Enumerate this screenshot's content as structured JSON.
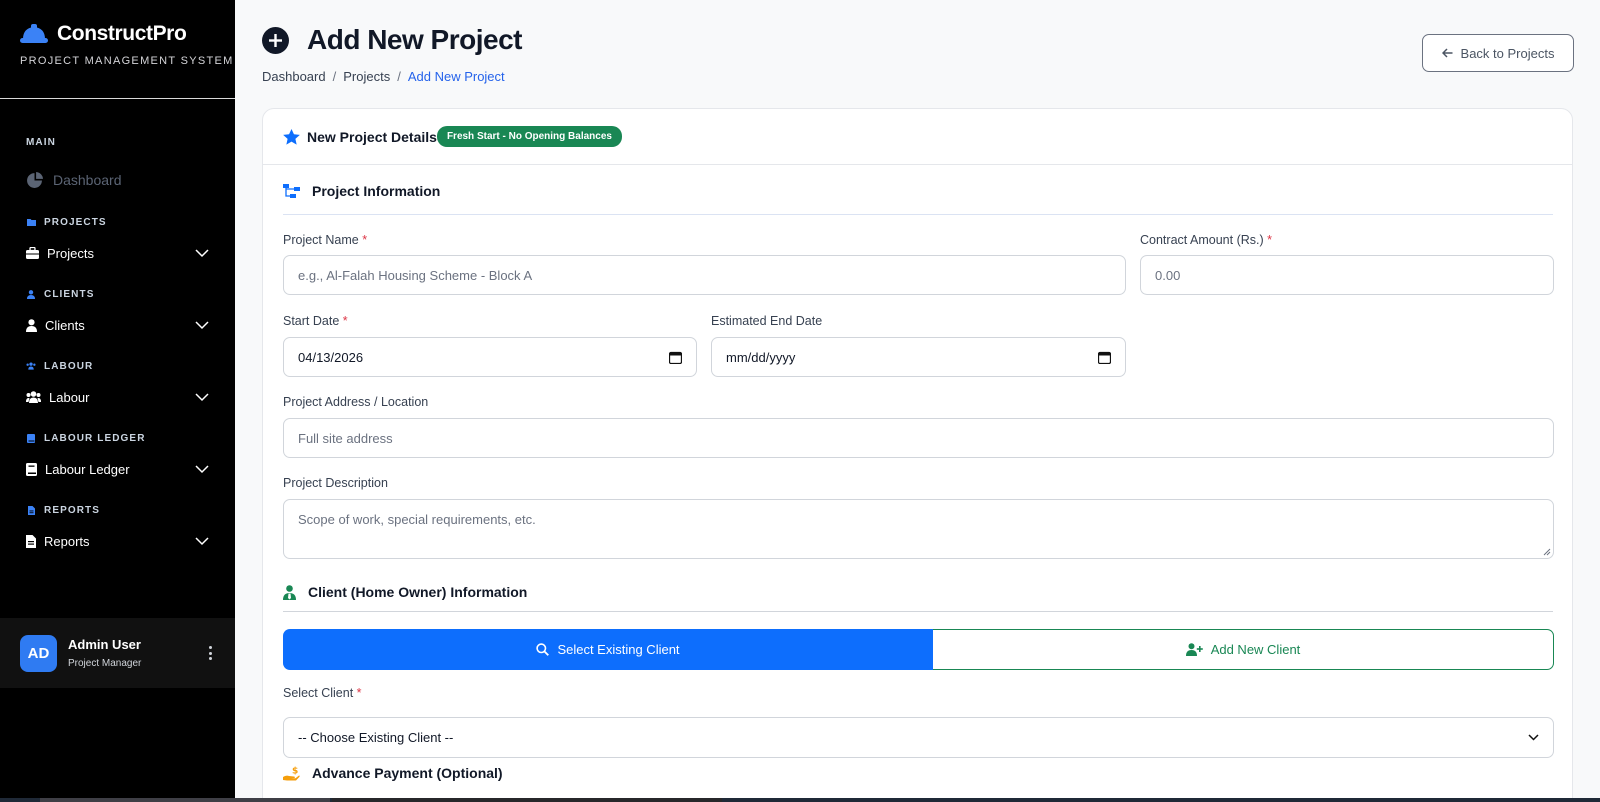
{
  "brand": {
    "name": "ConstructPro",
    "subtitle": "PROJECT MANAGEMENT SYSTEM"
  },
  "sidebar": {
    "main_label": "MAIN",
    "dashboard_label": "Dashboard",
    "sections": [
      {
        "title": "PROJECTS",
        "item": "Projects",
        "icon": "briefcase-icon"
      },
      {
        "title": "CLIENTS",
        "item": "Clients",
        "icon": "user-icon"
      },
      {
        "title": "LABOUR",
        "item": "Labour",
        "icon": "users-icon"
      },
      {
        "title": "LABOUR LEDGER",
        "item": "Labour Ledger",
        "icon": "book-icon"
      },
      {
        "title": "REPORTS",
        "item": "Reports",
        "icon": "file-icon"
      }
    ],
    "user": {
      "initials": "AD",
      "name": "Admin User",
      "role": "Project Manager"
    }
  },
  "header": {
    "title": "Add New Project",
    "breadcrumb": [
      "Dashboard",
      "Projects",
      "Add New Project"
    ],
    "back_label": "Back to Projects"
  },
  "card": {
    "title": "New Project Details",
    "badge": "Fresh Start - No Opening Balances"
  },
  "project_info": {
    "heading": "Project Information",
    "name_label": "Project Name",
    "name_placeholder": "e.g., Al-Falah Housing Scheme - Block A",
    "amount_label": "Contract Amount (Rs.)",
    "amount_placeholder": "0.00",
    "start_label": "Start Date",
    "start_value": "04/13/2026",
    "end_label": "Estimated End Date",
    "end_placeholder": "mm/dd/yyyy",
    "address_label": "Project Address / Location",
    "address_placeholder": "Full site address",
    "desc_label": "Project Description",
    "desc_placeholder": "Scope of work, special requirements, etc.",
    "required_mark": "*"
  },
  "client_info": {
    "heading": "Client (Home Owner) Information",
    "select_existing_label": "Select Existing Client",
    "add_new_label": "Add New Client",
    "select_label": "Select Client",
    "select_value": "-- Choose Existing Client --"
  },
  "advance": {
    "heading": "Advance Payment (Optional)"
  },
  "colors": {
    "primary": "#0d6efd",
    "success": "#198754",
    "danger": "#dc3545",
    "sidebar": "#000000"
  }
}
